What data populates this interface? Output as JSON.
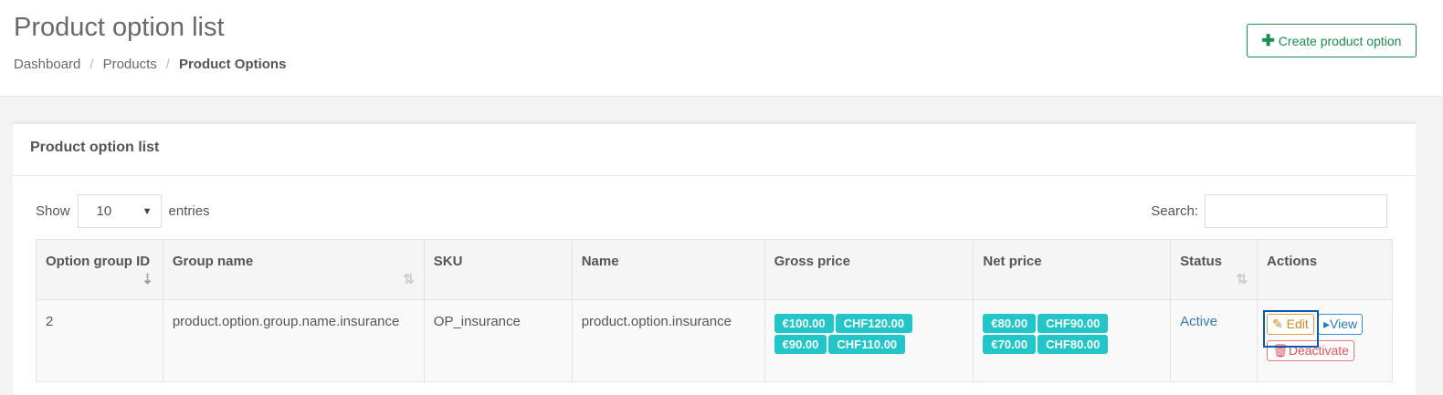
{
  "header": {
    "title": "Product option list",
    "breadcrumb": [
      "Dashboard",
      "Products",
      "Product Options"
    ],
    "create_label": "Create product option"
  },
  "card": {
    "title": "Product option list",
    "show_label": "Show",
    "entries_label": "entries",
    "page_size": "10",
    "search_label": "Search:",
    "search_value": ""
  },
  "table": {
    "columns": [
      "Option group ID",
      "Group name",
      "SKU",
      "Name",
      "Gross price",
      "Net price",
      "Status",
      "Actions"
    ],
    "rows": [
      {
        "id": "2",
        "group": "product.option.group.name.insurance",
        "sku": "OP_insurance",
        "name": "product.option.insurance",
        "gross": [
          "€100.00",
          "CHF120.00",
          "€90.00",
          "CHF110.00"
        ],
        "net": [
          "€80.00",
          "CHF90.00",
          "€70.00",
          "CHF80.00"
        ],
        "status": "Active",
        "actions": {
          "edit": "Edit",
          "view": "View",
          "deactivate": "Deactivate"
        }
      }
    ]
  },
  "colors": {
    "accent": "#1c8d4e",
    "badge": "#23c6c8",
    "edit": "#d08a1e",
    "view": "#2a7ac0",
    "danger": "#e8505b"
  }
}
